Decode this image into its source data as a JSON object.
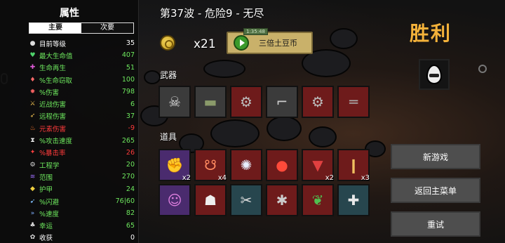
{
  "stats_panel": {
    "title": "属性",
    "tabs": [
      {
        "label": "主要",
        "active": true
      },
      {
        "label": "次要",
        "active": false
      }
    ],
    "rows": [
      {
        "icon": "level-icon",
        "label": "目前等级",
        "value": "35",
        "tone": "neu"
      },
      {
        "icon": "heart-icon",
        "label": "最大生命值",
        "value": "407",
        "tone": "pos"
      },
      {
        "icon": "regen-icon",
        "label": "生命再生",
        "value": "51",
        "tone": "pos"
      },
      {
        "icon": "lifesteal-icon",
        "label": "%生命窃取",
        "value": "100",
        "tone": "pos"
      },
      {
        "icon": "damage-icon",
        "label": "%伤害",
        "value": "798",
        "tone": "pos"
      },
      {
        "icon": "melee-icon",
        "label": "近战伤害",
        "value": "6",
        "tone": "pos"
      },
      {
        "icon": "ranged-icon",
        "label": "远程伤害",
        "value": "37",
        "tone": "pos"
      },
      {
        "icon": "elemental-icon",
        "label": "元素伤害",
        "value": "-9",
        "tone": "neg"
      },
      {
        "icon": "attack-speed-icon",
        "label": "%攻击速度",
        "value": "265",
        "tone": "pos"
      },
      {
        "icon": "crit-icon",
        "label": "%暴击率",
        "value": "26",
        "tone": "neg"
      },
      {
        "icon": "engineering-icon",
        "label": "工程学",
        "value": "20",
        "tone": "pos"
      },
      {
        "icon": "range-icon",
        "label": "范围",
        "value": "270",
        "tone": "pos"
      },
      {
        "icon": "armor-icon",
        "label": "护甲",
        "value": "24",
        "tone": "pos"
      },
      {
        "icon": "dodge-icon",
        "label": "%闪避",
        "value": "76|60",
        "tone": "pos"
      },
      {
        "icon": "speed-icon",
        "label": "%速度",
        "value": "82",
        "tone": "pos"
      },
      {
        "icon": "luck-icon",
        "label": "幸运",
        "value": "65",
        "tone": "pos"
      },
      {
        "icon": "harvest-icon",
        "label": "收获",
        "value": "0",
        "tone": "neu"
      }
    ]
  },
  "header": {
    "wave_text": "第37波 - 危险9 - 无尽",
    "coin_count": "x21",
    "triple_button_label": "三倍土豆币",
    "triple_button_tag": "1:35:48"
  },
  "weapons": {
    "label": "武器",
    "items": [
      {
        "icon": "skull-wrench-icon",
        "tier": "grey",
        "count": ""
      },
      {
        "icon": "cannon-icon",
        "tier": "grey",
        "count": ""
      },
      {
        "icon": "minigun-icon",
        "tier": "red",
        "count": ""
      },
      {
        "icon": "revolver-icon",
        "tier": "grey",
        "count": ""
      },
      {
        "icon": "gatling-icon",
        "tier": "red",
        "count": ""
      },
      {
        "icon": "shotgun-icon",
        "tier": "red",
        "count": ""
      }
    ]
  },
  "items": {
    "label": "道具",
    "row1": [
      {
        "icon": "robot-arm-icon",
        "tier": "purple",
        "count": "x2"
      },
      {
        "icon": "octopus-icon",
        "tier": "red",
        "count": "x4"
      },
      {
        "icon": "glowing-orb-icon",
        "tier": "red",
        "count": ""
      },
      {
        "icon": "tomato-icon",
        "tier": "red",
        "count": ""
      },
      {
        "icon": "red-cape-icon",
        "tier": "red",
        "count": "x2"
      },
      {
        "icon": "bullet-icon",
        "tier": "red",
        "count": "x3"
      }
    ],
    "row2": [
      {
        "icon": "creature-icon",
        "tier": "purple",
        "count": ""
      },
      {
        "icon": "ghost-icon",
        "tier": "red",
        "count": ""
      },
      {
        "icon": "claw-icon",
        "tier": "teal",
        "count": ""
      },
      {
        "icon": "spider-icon",
        "tier": "red",
        "count": ""
      },
      {
        "icon": "plant-icon",
        "tier": "red",
        "count": ""
      },
      {
        "icon": "medkit-icon",
        "tier": "teal",
        "count": ""
      }
    ]
  },
  "right_panel": {
    "result_title": "胜利",
    "character_icon": "egg-character-icon",
    "buttons": [
      "新游戏",
      "返回主菜单",
      "重试"
    ]
  },
  "colors": {
    "positive": "#6ee85e",
    "negative": "#ff3b3b",
    "victory": "#f4b23a",
    "button": "#4e4e4e"
  }
}
